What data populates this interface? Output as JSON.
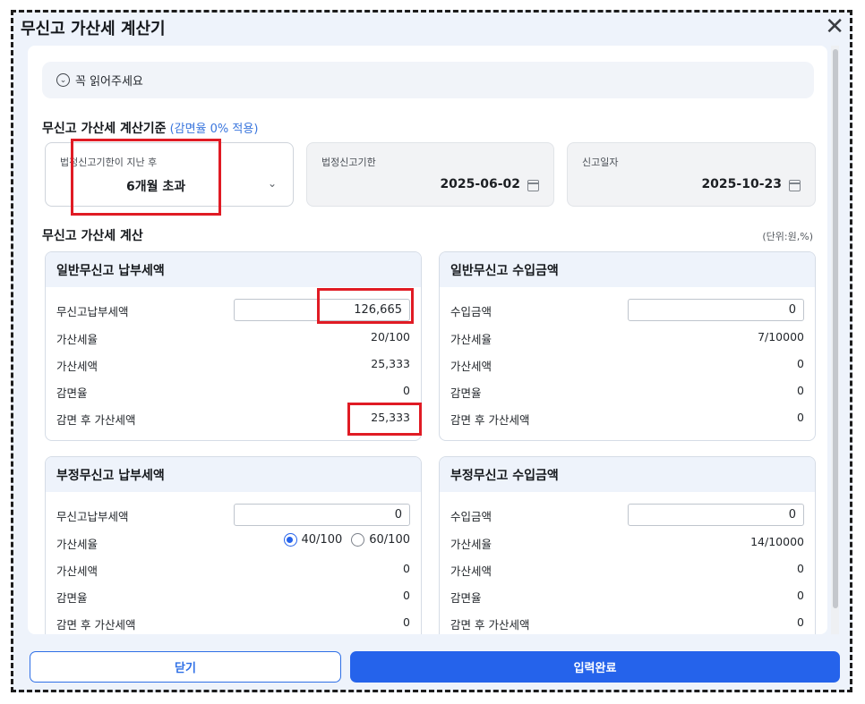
{
  "window": {
    "title": "무신고 가산세 계산기",
    "close_glyph": "✕"
  },
  "notice": {
    "label": "꼭 읽어주세요",
    "icon": "chevron-down-circle-icon"
  },
  "criteria": {
    "title": "무신고 가산세 계산기준",
    "subtitle": "(감면율 0% 적용)",
    "period": {
      "label": "법정신고기한이 지난 후",
      "value": "6개월 초과"
    },
    "deadline": {
      "label": "법정신고기한",
      "value": "2025-06-02"
    },
    "filing_date": {
      "label": "신고일자",
      "value": "2025-10-23"
    }
  },
  "calc": {
    "title": "무신고 가산세 계산",
    "unit": "(단위:원,%)",
    "general_tax": {
      "title": "일반무신고 납부세액",
      "rows": [
        {
          "label": "무신고납부세액",
          "value": "126,665"
        },
        {
          "label": "가산세율",
          "value": "20/100"
        },
        {
          "label": "가산세액",
          "value": "25,333"
        },
        {
          "label": "감면율",
          "value": "0"
        },
        {
          "label": "감면 후 가산세액",
          "value": "25,333"
        }
      ]
    },
    "general_income": {
      "title": "일반무신고 수입금액",
      "rows": [
        {
          "label": "수입금액",
          "value": "0"
        },
        {
          "label": "가산세율",
          "value": "7/10000"
        },
        {
          "label": "가산세액",
          "value": "0"
        },
        {
          "label": "감면율",
          "value": "0"
        },
        {
          "label": "감면 후 가산세액",
          "value": "0"
        }
      ]
    },
    "fraud_tax": {
      "title": "부정무신고 납부세액",
      "rows": [
        {
          "label": "무신고납부세액",
          "value": "0"
        },
        {
          "label": "가산세율",
          "option_a": "40/100",
          "option_b": "60/100",
          "selected": "40/100"
        },
        {
          "label": "가산세액",
          "value": "0"
        },
        {
          "label": "감면율",
          "value": "0"
        },
        {
          "label": "감면 후 가산세액",
          "value": "0"
        }
      ]
    },
    "fraud_income": {
      "title": "부정무신고 수입금액",
      "rows": [
        {
          "label": "수입금액",
          "value": "0"
        },
        {
          "label": "가산세율",
          "value": "14/10000"
        },
        {
          "label": "가산세액",
          "value": "0"
        },
        {
          "label": "감면율",
          "value": "0"
        },
        {
          "label": "감면 후 가산세액",
          "value": "0"
        }
      ]
    }
  },
  "footer": {
    "close_label": "닫기",
    "done_label": "입력완료"
  },
  "colors": {
    "accent": "#2563eb",
    "highlight": "#e01b24",
    "header_bg": "#eef3fb"
  }
}
